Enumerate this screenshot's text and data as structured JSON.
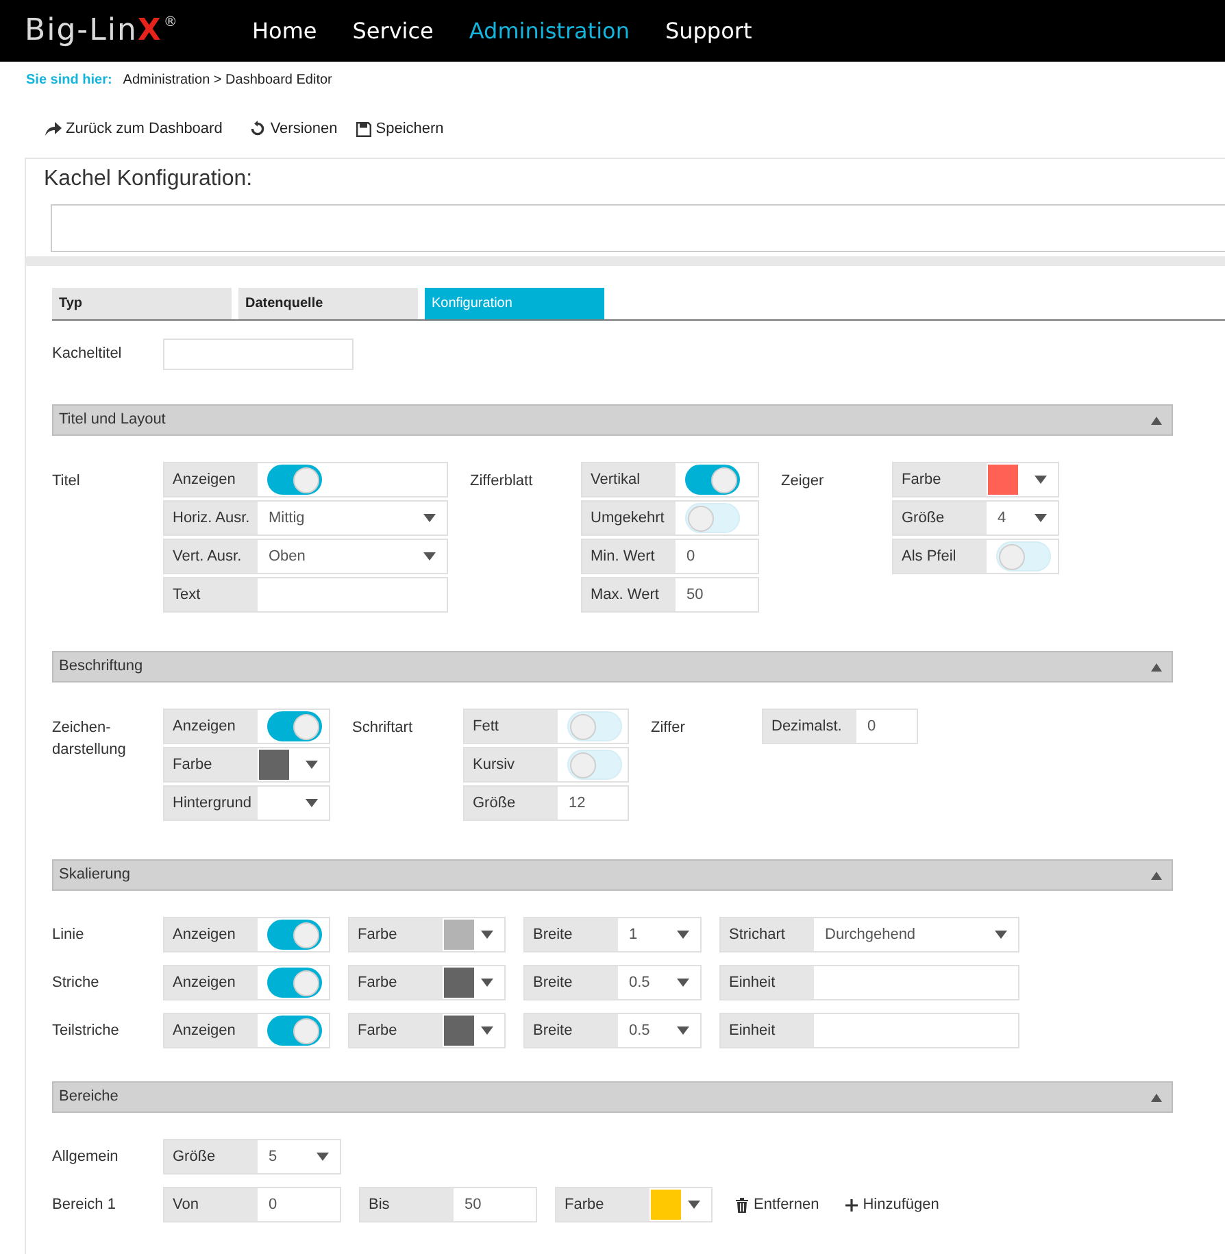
{
  "header": {
    "logo": {
      "text": "Big-Lin",
      "accent": "X",
      "mark": "®"
    },
    "nav": [
      {
        "label": "Home",
        "selected": false
      },
      {
        "label": "Service",
        "selected": false
      },
      {
        "label": "Administration",
        "selected": true
      },
      {
        "label": "Support",
        "selected": false
      }
    ]
  },
  "breadcrumb": {
    "label": "Sie sind hier:",
    "path": "Administration > Dashboard Editor"
  },
  "toolbar": [
    {
      "kind": "back",
      "label": "Zurück zum Dashboard"
    },
    {
      "kind": "versions",
      "label": "Versionen"
    },
    {
      "kind": "save",
      "label": "Speichern"
    }
  ],
  "panel": {
    "title": "Kachel Konfiguration:",
    "tabs": [
      {
        "label": "Typ",
        "selected": false
      },
      {
        "label": "Datenquelle",
        "selected": false
      },
      {
        "label": "Konfiguration",
        "selected": true
      }
    ],
    "tile_title": {
      "label": "Kacheltitel"
    },
    "sections": [
      {
        "title": "Titel und Layout",
        "expanded": true,
        "kind": "columns",
        "groups": [
          {
            "label": "Titel",
            "controls": [
              {
                "kind": "toggle",
                "label": "Anzeigen",
                "on": true
              },
              {
                "kind": "select",
                "label": "Horiz. Ausr.",
                "value": "Mittig"
              },
              {
                "kind": "select",
                "label": "Vert. Ausr.",
                "value": "Oben"
              },
              {
                "kind": "input",
                "label": "Text"
              }
            ]
          },
          {
            "label": "Zifferblatt",
            "controls": [
              {
                "kind": "toggle",
                "label": "Vertikal",
                "on": true
              },
              {
                "kind": "toggle",
                "label": "Umgekehrt",
                "on": false
              },
              {
                "kind": "input",
                "label": "Min. Wert",
                "value": "0"
              },
              {
                "kind": "input",
                "label": "Max. Wert",
                "value": "50"
              }
            ]
          },
          {
            "label": "Zeiger",
            "controls": [
              {
                "kind": "color",
                "label": "Farbe",
                "color": "#ff6155"
              },
              {
                "kind": "select",
                "label": "Größe",
                "value": "4"
              },
              {
                "kind": "toggle",
                "label": "Als Pfeil",
                "on": false
              }
            ]
          }
        ]
      },
      {
        "title": "Beschriftung",
        "expanded": true,
        "kind": "columns",
        "groups": [
          {
            "label": "Zeichen-darstellung",
            "controls": [
              {
                "kind": "toggle",
                "label": "Anzeigen",
                "on": true
              },
              {
                "kind": "color",
                "label": "Farbe",
                "color": "#646464"
              },
              {
                "kind": "color",
                "label": "Hintergrund"
              }
            ]
          },
          {
            "label": "Schriftart",
            "controls": [
              {
                "kind": "toggle",
                "label": "Fett",
                "on": false
              },
              {
                "kind": "toggle",
                "label": "Kursiv",
                "on": false
              },
              {
                "kind": "input",
                "label": "Größe",
                "value": "12"
              }
            ]
          },
          {
            "label": "Ziffer",
            "controls": [
              {
                "kind": "input",
                "label": "Dezimalst.",
                "value": "0"
              }
            ]
          }
        ]
      },
      {
        "title": "Skalierung",
        "expanded": true,
        "kind": "rows",
        "groups": [
          {
            "label": "Linie",
            "controls": [
              {
                "kind": "toggle",
                "label": "Anzeigen",
                "on": true
              },
              {
                "kind": "color",
                "label": "Farbe",
                "color": "#b3b3b3"
              },
              {
                "kind": "select",
                "label": "Breite",
                "value": "1"
              },
              {
                "kind": "select",
                "label": "Strichart",
                "value": "Durchgehend"
              }
            ]
          },
          {
            "label": "Striche",
            "controls": [
              {
                "kind": "toggle",
                "label": "Anzeigen",
                "on": true
              },
              {
                "kind": "color",
                "label": "Farbe",
                "color": "#646464"
              },
              {
                "kind": "select",
                "label": "Breite",
                "value": "0.5"
              },
              {
                "kind": "input",
                "label": "Einheit"
              }
            ]
          },
          {
            "label": "Teilstriche",
            "controls": [
              {
                "kind": "toggle",
                "label": "Anzeigen",
                "on": true
              },
              {
                "kind": "color",
                "label": "Farbe",
                "color": "#646464"
              },
              {
                "kind": "select",
                "label": "Breite",
                "value": "0.5"
              },
              {
                "kind": "input",
                "label": "Einheit"
              }
            ]
          }
        ]
      },
      {
        "title": "Bereiche",
        "expanded": true,
        "kind": "rows",
        "groups": [
          {
            "label": "Allgemein",
            "controls": [
              {
                "kind": "select",
                "label": "Größe",
                "value": "5"
              }
            ]
          },
          {
            "label": "Bereich 1",
            "controls": [
              {
                "kind": "input",
                "label": "Von",
                "value": "0"
              },
              {
                "kind": "input",
                "label": "Bis",
                "value": "50"
              },
              {
                "kind": "color",
                "label": "Farbe",
                "color": "#ffc800"
              },
              {
                "kind": "remove",
                "label": "Entfernen"
              },
              {
                "kind": "add",
                "label": "Hinzufügen"
              }
            ]
          }
        ]
      }
    ]
  }
}
